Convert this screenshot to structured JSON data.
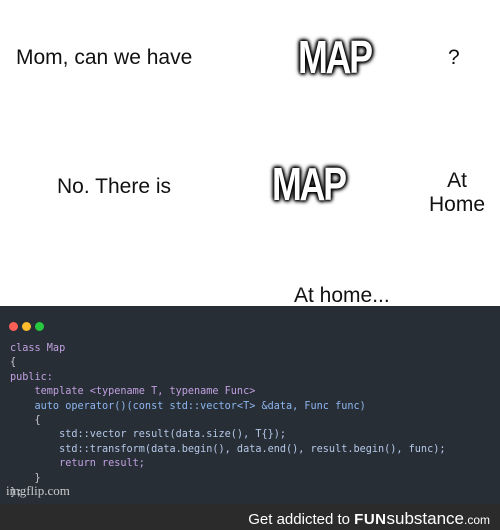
{
  "panel1": {
    "text": "Mom, can we have",
    "item": "MAP",
    "question": "?"
  },
  "panel2": {
    "text": "No. There is",
    "item": "MAP",
    "location_line1": "At",
    "location_line2": "Home"
  },
  "panel3": {
    "caption": "At home...",
    "window_dots": {
      "red": "#ff5f56",
      "yellow": "#ffbd2e",
      "green": "#27c93f"
    },
    "code_lines": [
      "class Map",
      "{",
      "public:",
      "    template <typename T, typename Func>",
      "    auto operator()(const std::vector<T> &data, Func func)",
      "    {",
      "        std::vector result(data.size(), T{});",
      "        std::transform(data.begin(), data.end(), result.begin(), func);",
      "        return result;",
      "    }",
      "};"
    ]
  },
  "watermark": "imgflip.com",
  "footer": {
    "prefix": "Get addicted to ",
    "brand_bold": "FUN",
    "brand_rest": "substance",
    "tld": ".com"
  }
}
